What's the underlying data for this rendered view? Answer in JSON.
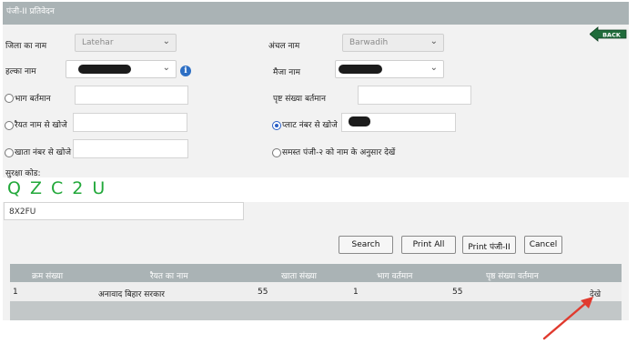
{
  "header": {
    "title": "पंजी-II प्रतिवेदन"
  },
  "back_button": {
    "label": "BACK"
  },
  "form": {
    "district_label": "जिला का नाम",
    "district_value": "Latehar",
    "zone_label": "अंचल नाम",
    "zone_value": "Barwadih",
    "halka_label": "हल्का नाम",
    "mauza_label": "मैजा नाम",
    "bhag_label": "भाग बर्तमान",
    "page_label": "पृष्ट संख्या बर्तमान",
    "raiyat_label": "रैयत नाम से खोजे",
    "plot_label": "प्लाट नंबर से खोजे",
    "khata_label": "खाता नंबर से खोजे",
    "all_label": "समस्त पंजी-२ को नाम के अनुसार देखें",
    "selected_search_mode": "plot",
    "captcha_label": "सुरक्षा कोड:",
    "captcha_text": "QZC2U",
    "captcha_input_value": "8X2FU"
  },
  "buttons": {
    "search": "Search",
    "print_all": "Print All",
    "print_panji": "Print पंजी-II",
    "cancel": "Cancel"
  },
  "table": {
    "headers": [
      "क्रम संख्या",
      "रैयत का नाम",
      "खाता संख्या",
      "भाग वर्तमान",
      "पृष्ठ संख्या वर्तमान"
    ],
    "rows": [
      {
        "serial": "1",
        "raiyat": "अनावाद बिहार सरकार",
        "khata": "55",
        "bhag": "1",
        "page": "55",
        "action": "देखे"
      }
    ]
  },
  "colors": {
    "header_bg": "#aab3b5",
    "panel_bg": "#f2f2f2",
    "captcha_green": "#22a83a",
    "back_green": "#1f6b3a",
    "arrow_red": "#e03a2e",
    "radio_blue": "#2b5fc6"
  }
}
